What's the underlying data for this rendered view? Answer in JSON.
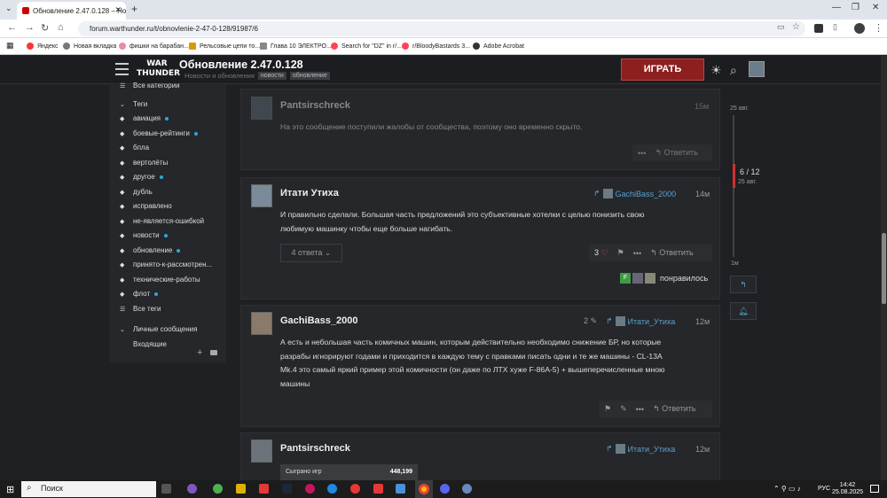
{
  "browser": {
    "tab_title": "Обновление 2.47.0.128 – Нов",
    "url": "forum.warthunder.ru/t/obnovlenie-2-47-0-128/91987/6",
    "bookmarks": [
      "Яндекс",
      "Новая вкладка",
      "фишки на барабан...",
      "Рельсовые цепи то...",
      "Глава 10 ЭЛЕКТРО...",
      "Search for \"DZ\" in r/...",
      "r/BloodyBastards 3...",
      "Adobe Acrobat"
    ]
  },
  "header": {
    "logo_line1": "WAR",
    "logo_line2": "THUNDER",
    "title": "Обновление 2.47.0.128",
    "breadcrumb": "Новости и обновления",
    "tags": [
      "новости",
      "обновление"
    ],
    "play_label": "ИГРАТЬ"
  },
  "sidebar": {
    "top_item": "Все категории",
    "tags_heading": "Теги",
    "tags": [
      {
        "label": "авиация",
        "dot": true
      },
      {
        "label": "боевые-рейтинги",
        "dot": true
      },
      {
        "label": "бпла",
        "dot": false
      },
      {
        "label": "вертолёты",
        "dot": false
      },
      {
        "label": "другое",
        "dot": true
      },
      {
        "label": "дубль",
        "dot": false
      },
      {
        "label": "исправлено",
        "dot": false
      },
      {
        "label": "не-является-ошибкой",
        "dot": false
      },
      {
        "label": "новости",
        "dot": true
      },
      {
        "label": "обновление",
        "dot": true
      },
      {
        "label": "принято-к-рассмотрен...",
        "dot": false
      },
      {
        "label": "технические-работы",
        "dot": false
      },
      {
        "label": "флот",
        "dot": true
      }
    ],
    "all_tags": "Все теги",
    "messages_heading": "Личные сообщения",
    "inbox": "Входящие"
  },
  "posts": [
    {
      "author": "Pantsirschreck",
      "time": "15м",
      "text": "На это сообщение поступили жалобы от сообщества, поэтому оно временно скрыто.",
      "reply_label": "Ответить"
    },
    {
      "author": "Итати Утиха",
      "time": "14м",
      "reply_to": "GachiBass_2000",
      "text1": "И правильно сделали. Большая часть предложений это субъективные хотелки с целью понизить свою",
      "text2": "любимую машинку чтобы еще больше нагибать.",
      "replies": "4 ответа",
      "likes": "3",
      "reply_label": "Ответить",
      "liked_by": "понравилось",
      "badge_letter": "F"
    },
    {
      "author": "GachiBass_2000",
      "time": "12м",
      "reply_to": "Итати_Утиха",
      "edits": "2",
      "text1": "А есть и небольшая часть комичных машин, которым действительно необходимо снижение БР, но которые",
      "text2": "разрабы игнорируют годами и приходится в каждую тему с правками писать одни и те же машины - CL-13A",
      "text3": "Mk.4 это самый яркий пример этой комичности (он даже по ЛТХ хуже F-86A-5) + вышеперечисленные мною",
      "text4": "машины",
      "reply_label": "Ответить"
    },
    {
      "author": "Pantsirschreck",
      "time": "12м",
      "reply_to": "Итати_Утиха",
      "stat_label": "Сыграно игр",
      "stat_value": "448,199"
    }
  ],
  "timeline": {
    "date_top": "25 авг.",
    "position": "6 / 12",
    "date_mid": "25 авг.",
    "bottom": "1м"
  },
  "taskbar": {
    "search": "Поиск",
    "lang": "РУС",
    "time": "14:42",
    "date": "25.08.2025"
  }
}
